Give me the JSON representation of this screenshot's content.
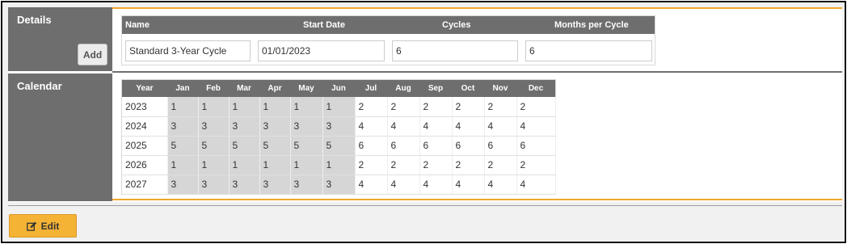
{
  "details": {
    "section_label": "Details",
    "add_label": "Add",
    "headers": {
      "name": "Name",
      "start_date": "Start Date",
      "cycles": "Cycles",
      "months_per_cycle": "Months per Cycle"
    },
    "values": {
      "name": "Standard 3-Year Cycle",
      "start_date": "01/01/2023",
      "cycles": "6",
      "months_per_cycle": "6"
    }
  },
  "calendar": {
    "section_label": "Calendar",
    "columns": [
      "Year",
      "Jan",
      "Feb",
      "Mar",
      "Apr",
      "May",
      "Jun",
      "Jul",
      "Aug",
      "Sep",
      "Oct",
      "Nov",
      "Dec"
    ],
    "rows": [
      [
        "2023",
        "1",
        "1",
        "1",
        "1",
        "1",
        "1",
        "2",
        "2",
        "2",
        "2",
        "2",
        "2"
      ],
      [
        "2024",
        "3",
        "3",
        "3",
        "3",
        "3",
        "3",
        "4",
        "4",
        "4",
        "4",
        "4",
        "4"
      ],
      [
        "2025",
        "5",
        "5",
        "5",
        "5",
        "5",
        "5",
        "6",
        "6",
        "6",
        "6",
        "6",
        "6"
      ],
      [
        "2026",
        "1",
        "1",
        "1",
        "1",
        "1",
        "1",
        "2",
        "2",
        "2",
        "2",
        "2",
        "2"
      ],
      [
        "2027",
        "3",
        "3",
        "3",
        "3",
        "3",
        "3",
        "4",
        "4",
        "4",
        "4",
        "4",
        "4"
      ]
    ]
  },
  "footer": {
    "edit_label": "Edit",
    "edit_icon": "edit-icon"
  },
  "colors": {
    "accent": "#f0a82b",
    "header_gray": "#6e6e6e",
    "shade": "#d6d6d6"
  }
}
